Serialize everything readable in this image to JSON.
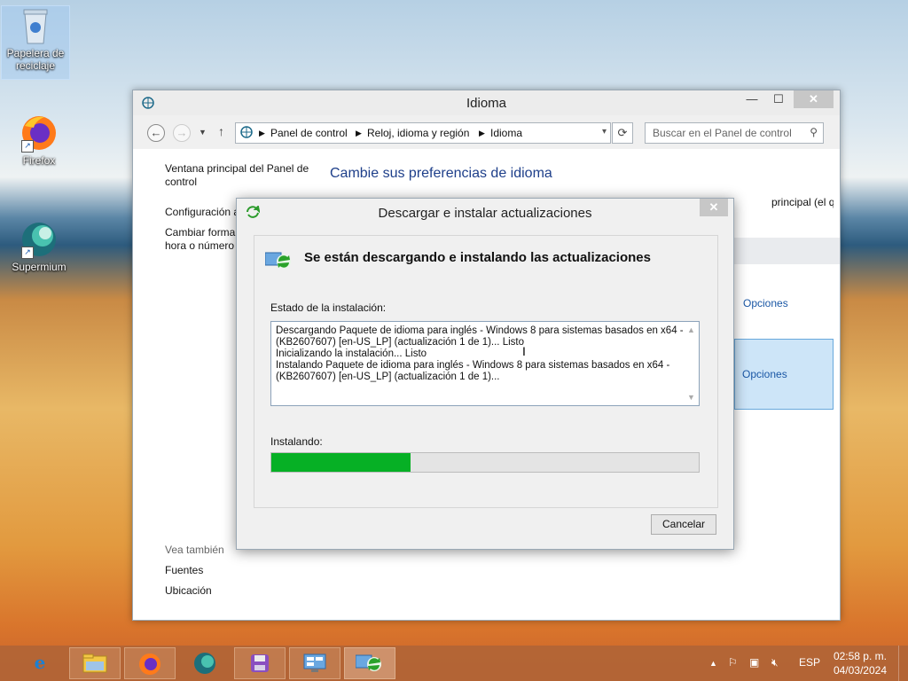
{
  "desktop": {
    "icons": [
      {
        "label": "Papelera de reciclaje",
        "icon": "recycle-bin-icon"
      },
      {
        "label": "Firefox",
        "icon": "firefox-icon"
      },
      {
        "label": "Supermium",
        "icon": "supermium-icon"
      }
    ]
  },
  "control_panel": {
    "title": "Idioma",
    "breadcrumb": [
      "Panel de control",
      "Reloj, idioma y región",
      "Idioma"
    ],
    "search_placeholder": "Buscar en el Panel de control",
    "left_nav": {
      "home": "Ventana principal del Panel de control",
      "advanced": "Configuración a",
      "format": "Cambiar forma",
      "format2": "hora o número",
      "see_also": "Vea también",
      "fonts": "Fuentes",
      "location": "Ubicación"
    },
    "heading": "Cambie sus preferencias de idioma",
    "description_tail": "principal (el que",
    "options": [
      "Opciones",
      "Opciones"
    ]
  },
  "dialog": {
    "title": "Descargar e instalar actualizaciones",
    "headline": "Se están descargando e instalando las actualizaciones",
    "status_label": "Estado de la instalación:",
    "log_lines": [
      "Descargando Paquete de idioma para inglés - Windows 8 para sistemas basados en x64 -",
      "(KB2607607) [en-US_LP] (actualización 1 de 1)... Listo",
      "Inicializando la instalación... Listo",
      "Instalando Paquete de idioma para inglés - Windows 8 para sistemas basados en x64 -",
      "(KB2607607) [en-US_LP] (actualización 1 de 1)..."
    ],
    "progress_label": "Instalando:",
    "progress_fraction": 0.325,
    "cancel_label": "Cancelar",
    "progress_color": "#06b025"
  },
  "taskbar": {
    "items": [
      "internet-explorer-icon",
      "file-explorer-icon",
      "firefox-icon",
      "supermium-icon",
      "floppy-app-icon",
      "control-panel-icon",
      "windows-update-icon"
    ],
    "language": "ESP",
    "time": "02:58 p. m.",
    "date": "04/03/2024"
  }
}
